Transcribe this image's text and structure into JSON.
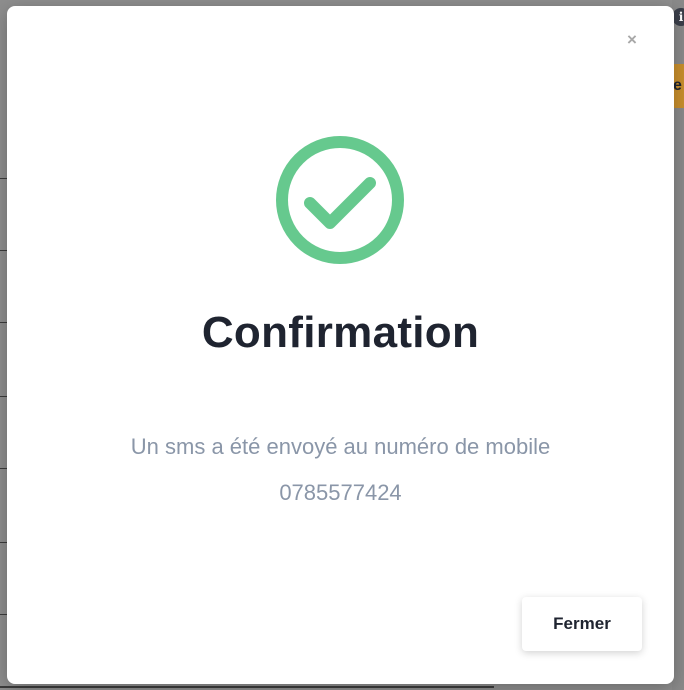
{
  "background": {
    "info_icon": "info-icon",
    "partial_button_text": "e"
  },
  "modal": {
    "close_icon": "close-icon",
    "close_glyph": "×",
    "status_icon": "check-circle-icon",
    "title": "Confirmation",
    "message_line1": "Un sms a été envoyé au numéro de mobile",
    "message_line2": "0785577424",
    "button_label": "Fermer"
  },
  "colors": {
    "success": "#66c98e",
    "title": "#1f2430",
    "message": "#8a96a8"
  }
}
